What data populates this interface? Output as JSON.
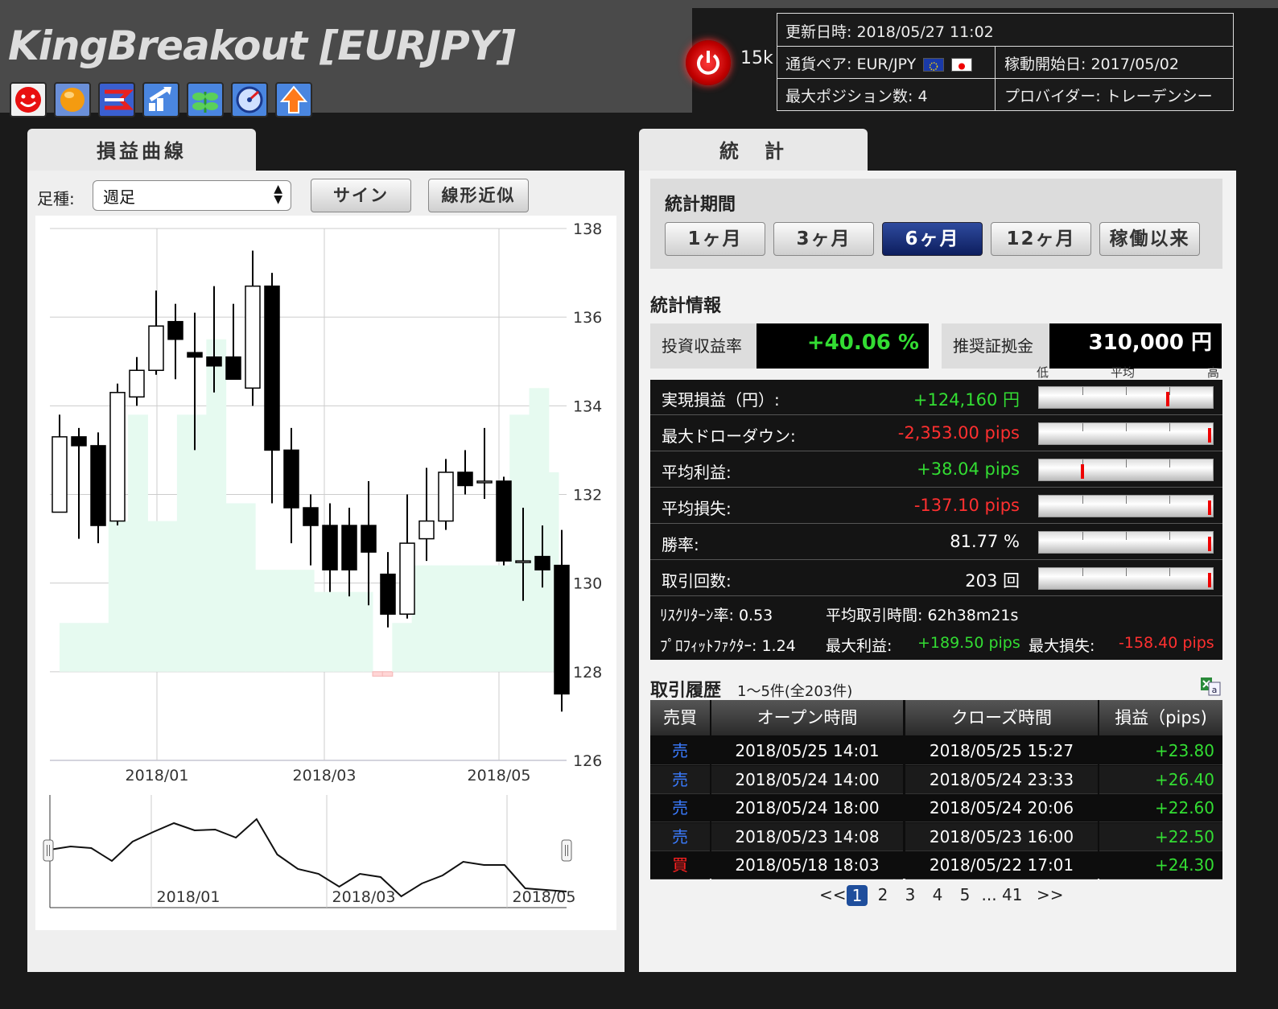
{
  "header": {
    "title": "KingBreakout [EURJPY]",
    "count": "15k",
    "updated": "更新日時: 2018/05/27 11:02",
    "pair_label": "通貨ペア: EUR/JPY",
    "start": "稼動開始日: 2017/05/02",
    "max_pos": "最大ポジション数: 4",
    "provider": "プロバイダー: トレーデンシー"
  },
  "toolbar_icons": [
    "smiley-icon",
    "orange-ball-icon",
    "trend-arrows-icon",
    "uptrend-icon",
    "leaf-icon",
    "gauge-icon",
    "up-arrow-icon"
  ],
  "left": {
    "tab": "損益曲線",
    "foot_label": "足種:",
    "foot_value": "週足",
    "sign_btn": "サイン",
    "linear_btn": "線形近似"
  },
  "chart_data": {
    "type": "candlestick",
    "y_ticks": [
      "138",
      "136",
      "134",
      "132",
      "130",
      "128",
      "126"
    ],
    "ylim": [
      126,
      138
    ],
    "x_ticks": [
      "2018/01",
      "2018/03",
      "2018/05"
    ],
    "candles": [
      {
        "o": 131.6,
        "h": 133.8,
        "l": 131.6,
        "c": 133.3
      },
      {
        "o": 133.3,
        "h": 133.5,
        "l": 131.0,
        "c": 133.1
      },
      {
        "o": 133.1,
        "h": 133.4,
        "l": 130.9,
        "c": 131.3
      },
      {
        "o": 131.4,
        "h": 134.5,
        "l": 131.3,
        "c": 134.3
      },
      {
        "o": 134.2,
        "h": 135.1,
        "l": 134.0,
        "c": 134.8
      },
      {
        "o": 134.8,
        "h": 136.6,
        "l": 134.7,
        "c": 135.8
      },
      {
        "o": 135.9,
        "h": 136.3,
        "l": 134.6,
        "c": 135.5
      },
      {
        "o": 135.2,
        "h": 136.1,
        "l": 133.0,
        "c": 135.1
      },
      {
        "o": 135.1,
        "h": 136.7,
        "l": 134.3,
        "c": 134.9
      },
      {
        "o": 135.1,
        "h": 136.3,
        "l": 134.7,
        "c": 134.6
      },
      {
        "o": 134.4,
        "h": 137.5,
        "l": 134.0,
        "c": 136.7
      },
      {
        "o": 136.7,
        "h": 137.0,
        "l": 131.8,
        "c": 133.0
      },
      {
        "o": 133.0,
        "h": 133.5,
        "l": 130.9,
        "c": 131.7
      },
      {
        "o": 131.7,
        "h": 132.0,
        "l": 130.4,
        "c": 131.3
      },
      {
        "o": 131.3,
        "h": 131.8,
        "l": 129.8,
        "c": 130.3
      },
      {
        "o": 131.3,
        "h": 131.7,
        "l": 129.7,
        "c": 130.3
      },
      {
        "o": 131.3,
        "h": 132.3,
        "l": 129.5,
        "c": 130.7
      },
      {
        "o": 130.2,
        "h": 130.7,
        "l": 129.0,
        "c": 129.3
      },
      {
        "o": 129.3,
        "h": 132.0,
        "l": 129.2,
        "c": 130.9
      },
      {
        "o": 131.0,
        "h": 132.6,
        "l": 130.5,
        "c": 131.4
      },
      {
        "o": 131.4,
        "h": 132.8,
        "l": 131.2,
        "c": 132.5
      },
      {
        "o": 132.5,
        "h": 133.0,
        "l": 132.0,
        "c": 132.2
      },
      {
        "o": 132.3,
        "h": 133.5,
        "l": 131.9,
        "c": 132.3
      },
      {
        "o": 132.3,
        "h": 132.4,
        "l": 130.4,
        "c": 130.5
      },
      {
        "o": 130.5,
        "h": 131.7,
        "l": 129.6,
        "c": 130.5
      },
      {
        "o": 130.6,
        "h": 131.3,
        "l": 129.9,
        "c": 130.3
      },
      {
        "o": 130.4,
        "h": 131.2,
        "l": 127.1,
        "c": 127.5
      }
    ],
    "equity_steps": [
      129.1,
      129.1,
      129.1,
      129.1,
      129.1,
      131.4,
      131.4,
      133.8,
      133.8,
      131.4,
      131.4,
      131.4,
      133.8,
      133.8,
      133.8,
      135.5,
      135.5,
      131.8,
      131.8,
      131.8,
      130.3,
      130.3,
      130.3,
      130.3,
      130.3,
      130.3,
      129.8,
      129.8,
      129.8,
      129.8,
      129.8,
      129.8,
      127.9,
      127.9,
      129.1,
      129.1,
      130.4,
      130.4,
      130.4,
      130.4,
      130.4,
      130.4,
      130.4,
      130.4,
      130.4,
      130.4,
      133.8,
      133.8,
      134.4,
      134.4,
      132.5
    ],
    "navigator_x_ticks": [
      "2018/01",
      "2018/03",
      "2018/05"
    ],
    "navigator_values": [
      0.62,
      0.66,
      0.64,
      0.48,
      0.72,
      0.84,
      0.95,
      0.86,
      0.87,
      0.77,
      1.0,
      0.56,
      0.38,
      0.32,
      0.16,
      0.32,
      0.28,
      0.04,
      0.2,
      0.3,
      0.47,
      0.43,
      0.43,
      0.14,
      0.12,
      0.1
    ]
  },
  "right": {
    "tab": "統　計",
    "period_title": "統計期間",
    "periods": [
      "1ヶ月",
      "3ヶ月",
      "6ヶ月",
      "12ヶ月",
      "稼働以来"
    ],
    "active_period": 2,
    "info_title": "統計情報",
    "roi_label": "投資収益率",
    "roi_value": "+40.06 %",
    "margin_label": "推奨証拠金",
    "margin_value": "310,000 円",
    "gauge_labels": [
      "低",
      "平均",
      "高"
    ],
    "rows": [
      {
        "label": "実現損益（円）:",
        "value": "+124,160 円",
        "color": "#33dd33",
        "mark": 0.74
      },
      {
        "label": "最大ドローダウン:",
        "value": "-2,353.00 pips",
        "color": "#ff3030",
        "mark": 0.98
      },
      {
        "label": "平均利益:",
        "value": "+38.04 pips",
        "color": "#33dd33",
        "mark": 0.25
      },
      {
        "label": "平均損失:",
        "value": "-137.10 pips",
        "color": "#ff3030",
        "mark": 0.98
      },
      {
        "label": "勝率:",
        "value": "81.77 %",
        "color": "#ffffff",
        "mark": 0.98
      },
      {
        "label": "取引回数:",
        "value": "203 回",
        "color": "#ffffff",
        "mark": 0.98
      }
    ],
    "risk_return": "ﾘｽｸﾘﾀｰﾝ率: 0.53",
    "avg_time": "平均取引時間: 62h38m21s",
    "profit_factor": "ﾌﾟﾛﾌｨｯﾄﾌｧｸﾀｰ: 1.24",
    "max_profit_label": "最大利益:",
    "max_profit": "+189.50 pips",
    "max_loss_label": "最大損失:",
    "max_loss": "-158.40 pips",
    "history_title": "取引履歴",
    "history_sub": "1〜5件(全203件)",
    "history_headers": [
      "売買",
      "オープン時間",
      "クローズ時間",
      "損益（pips)"
    ],
    "trades": [
      {
        "side": "売",
        "open": "2018/05/25 14:01",
        "close": "2018/05/25 15:27",
        "pl": "+23.80",
        "side_color": "#3a7bff"
      },
      {
        "side": "売",
        "open": "2018/05/24 14:00",
        "close": "2018/05/24 23:33",
        "pl": "+26.40",
        "side_color": "#3a7bff"
      },
      {
        "side": "売",
        "open": "2018/05/24 18:00",
        "close": "2018/05/24 20:06",
        "pl": "+22.60",
        "side_color": "#3a7bff"
      },
      {
        "side": "売",
        "open": "2018/05/23 14:08",
        "close": "2018/05/23 16:00",
        "pl": "+22.50",
        "side_color": "#3a7bff"
      },
      {
        "side": "買",
        "open": "2018/05/18 18:03",
        "close": "2018/05/22 17:01",
        "pl": "+24.30",
        "side_color": "#ff2020"
      }
    ],
    "pagination": [
      "<<",
      "1",
      "2",
      "3",
      "4",
      "5",
      "... 41",
      ">>"
    ],
    "active_page": 1
  },
  "colors": {
    "profit": "#33dd33",
    "loss": "#ff3030",
    "active_btn": "#1a2f78",
    "equity_fill": "#e6faf0",
    "drawdown_fill": "#ffd6d6"
  }
}
